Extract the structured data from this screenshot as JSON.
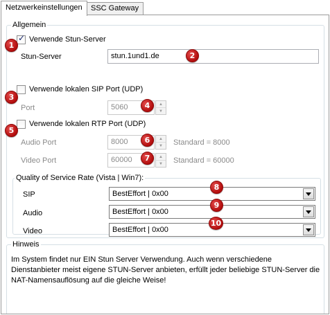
{
  "tabs": [
    {
      "label": "Netzwerkeinstellungen",
      "active": true
    },
    {
      "label": "SSC Gateway",
      "active": false
    }
  ],
  "general": {
    "title": "Allgemein",
    "use_stun": {
      "label": "Verwende Stun-Server",
      "checked": true
    },
    "stun_server": {
      "label": "Stun-Server",
      "value": "stun.1und1.de"
    },
    "use_sip_port": {
      "label": "Verwende lokalen SIP Port (UDP)",
      "checked": false
    },
    "port": {
      "label": "Port",
      "value": "5060"
    },
    "use_rtp_port": {
      "label": "Verwende lokalen RTP Port (UDP)",
      "checked": false
    },
    "audio_port": {
      "label": "Audio Port",
      "value": "8000",
      "default": "Standard = 8000"
    },
    "video_port": {
      "label": "Video Port",
      "value": "60000",
      "default": "Standard = 60000"
    }
  },
  "qos": {
    "title": "Quality of Service Rate (Vista | Win7):",
    "rows": [
      {
        "label": "SIP",
        "value": "BestEffort | 0x00"
      },
      {
        "label": "Audio",
        "value": "BestEffort | 0x00"
      },
      {
        "label": "Video",
        "value": "BestEffort | 0x00"
      }
    ]
  },
  "hint": {
    "title": "Hinweis",
    "text": "Im System findet nur EIN Stun Server Verwendung. Auch wenn verschiedene Dienstanbieter meist eigene STUN-Server anbieten, erfüllt jeder beliebige STUN-Server die NAT-Namensauflösung auf die gleiche Weise!"
  },
  "badges": [
    "1",
    "2",
    "3",
    "4",
    "5",
    "6",
    "7",
    "8",
    "9",
    "10"
  ],
  "colors": {
    "badge": "#c41616",
    "border": "#d5dfe5"
  }
}
